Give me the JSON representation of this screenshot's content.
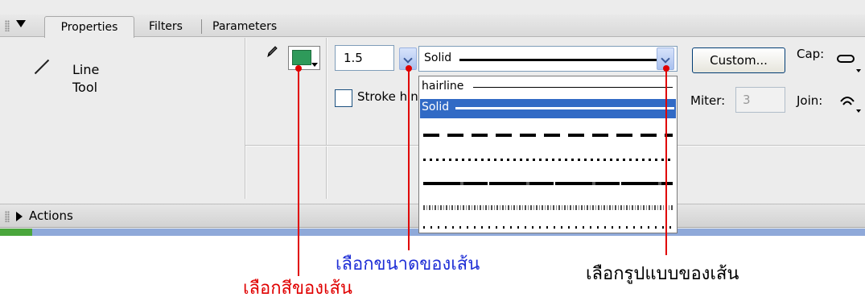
{
  "tabs": [
    {
      "label": "Properties",
      "active": true
    },
    {
      "label": "Filters",
      "active": false
    },
    {
      "label": "Parameters",
      "active": false
    }
  ],
  "tool": {
    "line1": "Line",
    "line2": "Tool"
  },
  "stroke": {
    "color": "#2e9a5a",
    "size_value": "1.5",
    "style_value": "Solid",
    "hinting_label": "Stroke hinting"
  },
  "style_options": [
    {
      "label": "hairline",
      "selected": false
    },
    {
      "label": "Solid",
      "selected": true
    },
    {
      "label": "",
      "pattern": "dashed"
    },
    {
      "label": "",
      "pattern": "dotted"
    },
    {
      "label": "",
      "pattern": "ragged"
    },
    {
      "label": "",
      "pattern": "stipple"
    },
    {
      "label": "",
      "pattern": "hatched"
    }
  ],
  "buttons": {
    "custom": "Custom..."
  },
  "labels": {
    "cap": "Cap:",
    "miter": "Miter:",
    "join": "Join:"
  },
  "miter_value": "3",
  "actions_label": "Actions",
  "annotations": {
    "size": "เลือกขนาดของเส้น",
    "style": "เลือกรูปแบบของเส้น",
    "color": "เลือกสีของเส้น"
  },
  "colors": {
    "annotation_red": "#e00000",
    "annotation_blue": "#1f2fd6",
    "selection": "#316ac5"
  }
}
